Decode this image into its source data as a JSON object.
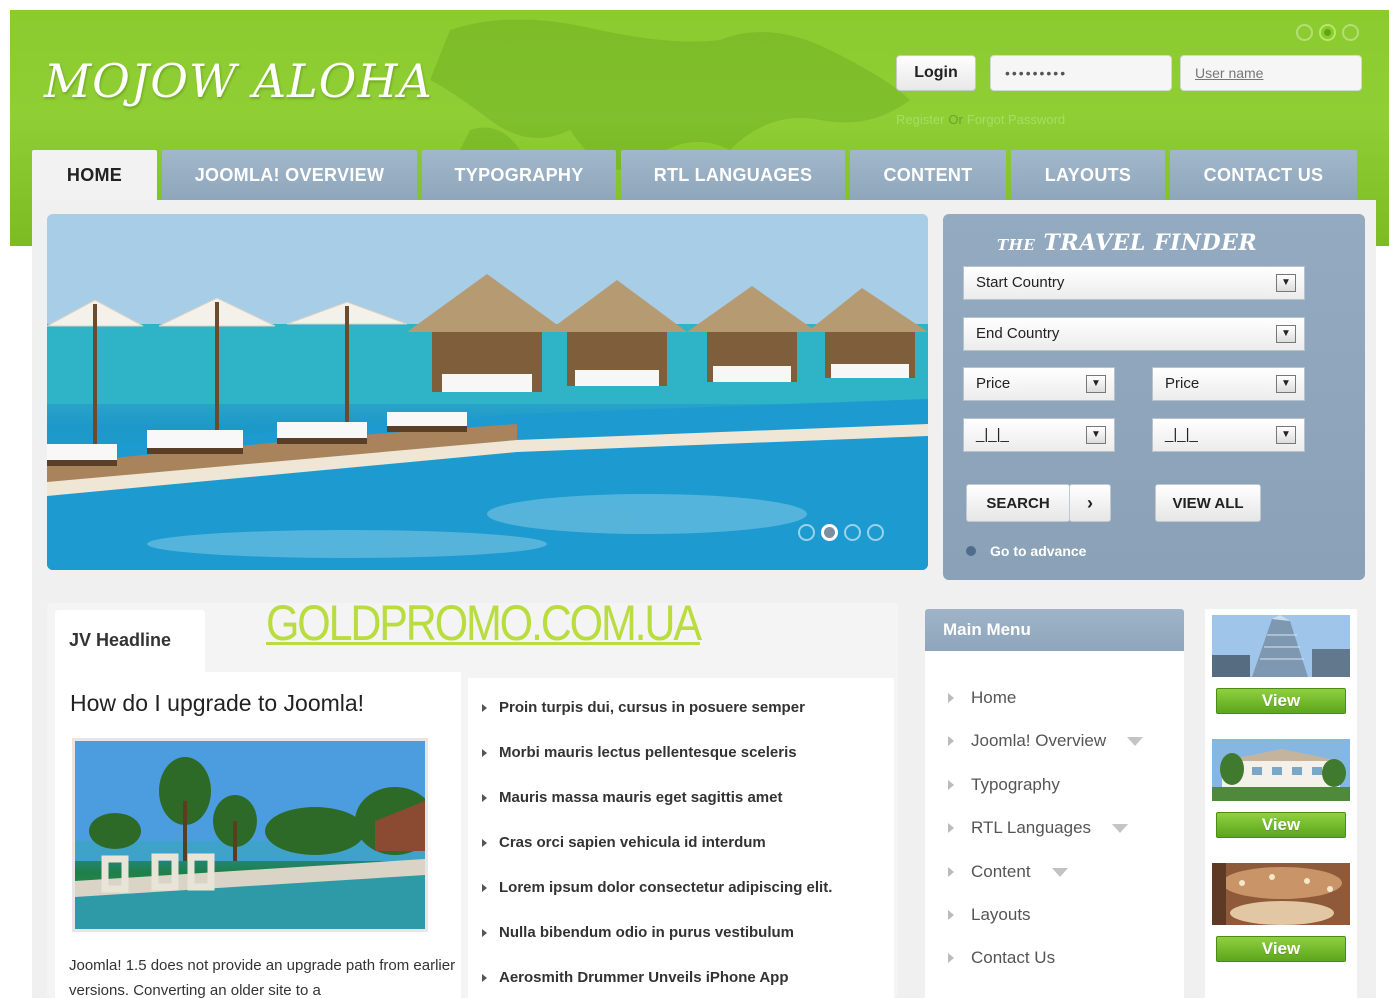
{
  "header": {
    "logo": "MOJOW ALOHA",
    "theme_dots": [
      "theme-1",
      "theme-2",
      "theme-3"
    ],
    "accent_color": "#8ccb2e"
  },
  "login": {
    "button_label": "Login",
    "password_value": "•••••••••",
    "username_placeholder": "User name",
    "register_link": "Register",
    "separator": "Or",
    "forgot_link": "Forgot Password"
  },
  "nav": {
    "tabs": [
      {
        "label": "HOME",
        "active": true
      },
      {
        "label": "JOOMLA! OVERVIEW"
      },
      {
        "label": "TYPOGRAPHY"
      },
      {
        "label": "RTL LANGUAGES"
      },
      {
        "label": "CONTENT"
      },
      {
        "label": "LAYOUTS"
      },
      {
        "label": "CONTACT US"
      }
    ]
  },
  "slideshow": {
    "active_slide": 1,
    "slide_count": 4
  },
  "travel_finder": {
    "title_small": "THE",
    "title_large": "TRAVEL FINDER",
    "start_country": "Start Country",
    "end_country": "End Country",
    "price_from": "Price",
    "price_to": "Price",
    "date_from": "_|_|_",
    "date_to": "_|_|_",
    "search_label": "SEARCH",
    "search_arrow": "›",
    "view_all_label": "VIEW ALL",
    "advance_link": "Go to advance"
  },
  "headline": {
    "tab_label": "JV Headline",
    "watermark": "GOLDPROMO.COM.UA",
    "article_title": "How do I upgrade to Joomla!",
    "article_text": "Joomla! 1.5 does not provide an upgrade path from earlier versions. Converting an older site to a",
    "items": [
      "Proin turpis dui, cursus in posuere semper",
      "Morbi mauris lectus pellentesque sceleris",
      "Mauris massa mauris eget sagittis amet",
      "Cras orci sapien vehicula id interdum",
      "Lorem ipsum dolor consectetur adipiscing elit.",
      "Nulla bibendum odio in purus vestibulum",
      "Aerosmith Drummer Unveils iPhone App"
    ]
  },
  "main_menu": {
    "title": "Main Menu",
    "items": [
      {
        "label": "Home",
        "has_children": false
      },
      {
        "label": "Joomla! Overview",
        "has_children": true
      },
      {
        "label": "Typography",
        "has_children": false
      },
      {
        "label": "RTL Languages",
        "has_children": true
      },
      {
        "label": "Content",
        "has_children": true
      },
      {
        "label": "Layouts",
        "has_children": false
      },
      {
        "label": "Contact Us",
        "has_children": false
      }
    ]
  },
  "thumbnails": {
    "view_label": "View",
    "items": [
      "building-photo",
      "hotel-photo",
      "lobby-photo"
    ]
  }
}
